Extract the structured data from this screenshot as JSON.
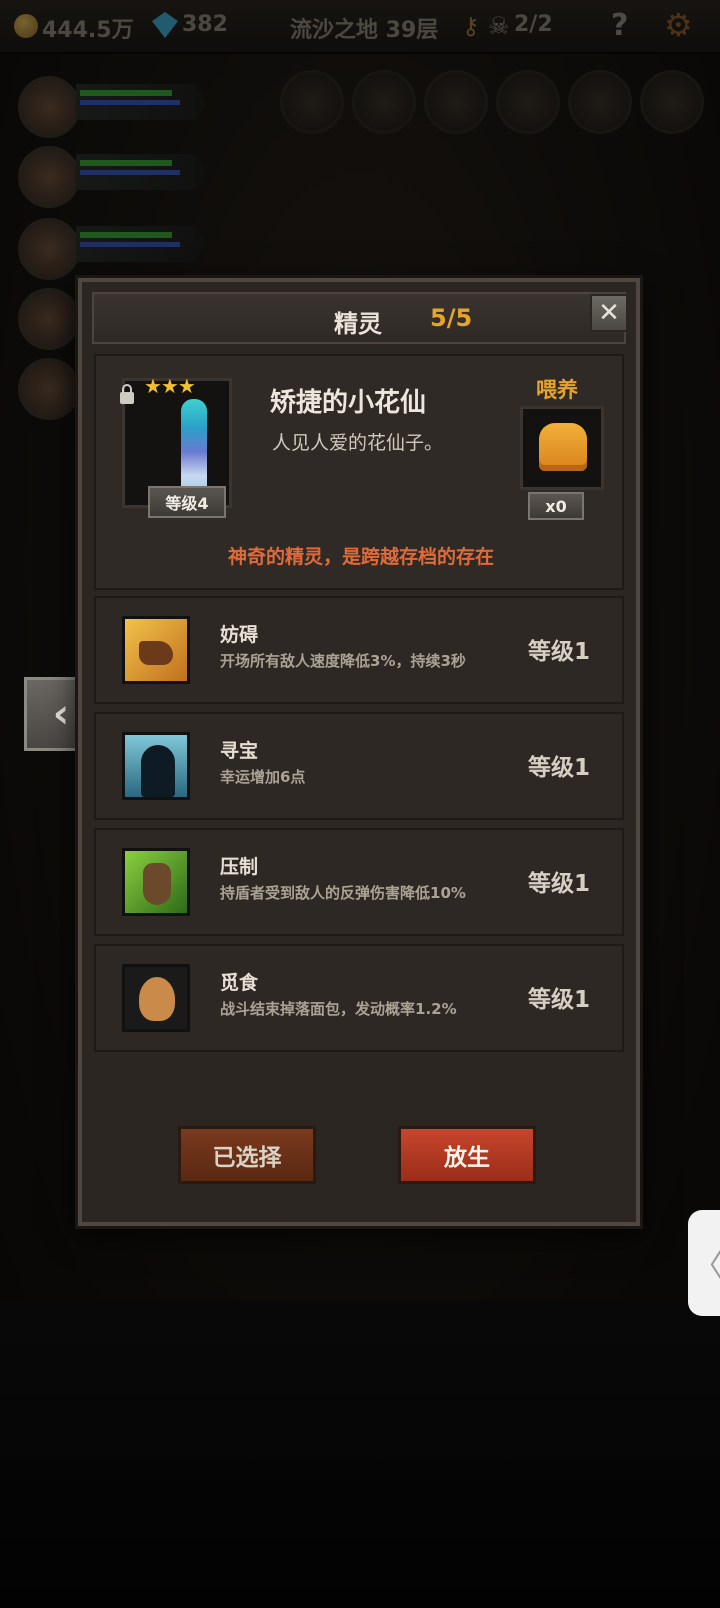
{
  "top_bar": {
    "gold": "444.5万",
    "gems": "382",
    "location": "流沙之地 39层",
    "skull_count": "2/2",
    "icons": [
      "coin-icon",
      "gem-icon",
      "key-icon",
      "skull-icon",
      "help-icon",
      "settings-icon"
    ]
  },
  "dialog": {
    "title": "精灵",
    "count": "5/5",
    "close_icon": "close-icon",
    "spirit": {
      "stars": "★★★",
      "level": "等级4",
      "name": "矫捷的小花仙",
      "description": "人见人爱的花仙子。",
      "feed_label": "喂养",
      "feed_count": "x0",
      "note": "神奇的精灵，是跨越存档的存在"
    },
    "skills": [
      {
        "name": "妨碍",
        "description": "开场所有敌人速度降低3%，持续3秒",
        "level": "等级1",
        "icon": "chained-boot-icon"
      },
      {
        "name": "寻宝",
        "description": "幸运增加6点",
        "level": "等级1",
        "icon": "starry-silhouette-icon"
      },
      {
        "name": "压制",
        "description": "持盾者受到敌人的反弹伤害降低10%",
        "level": "等级1",
        "icon": "claw-icon"
      },
      {
        "name": "觅食",
        "description": "战斗结束掉落面包，发动概率1.2%",
        "level": "等级1",
        "icon": "gingerbread-icon"
      }
    ],
    "buttons": {
      "selected": "已选择",
      "release": "放生"
    }
  },
  "side": {
    "left_arrow": "‹",
    "right_tab": "〈"
  }
}
